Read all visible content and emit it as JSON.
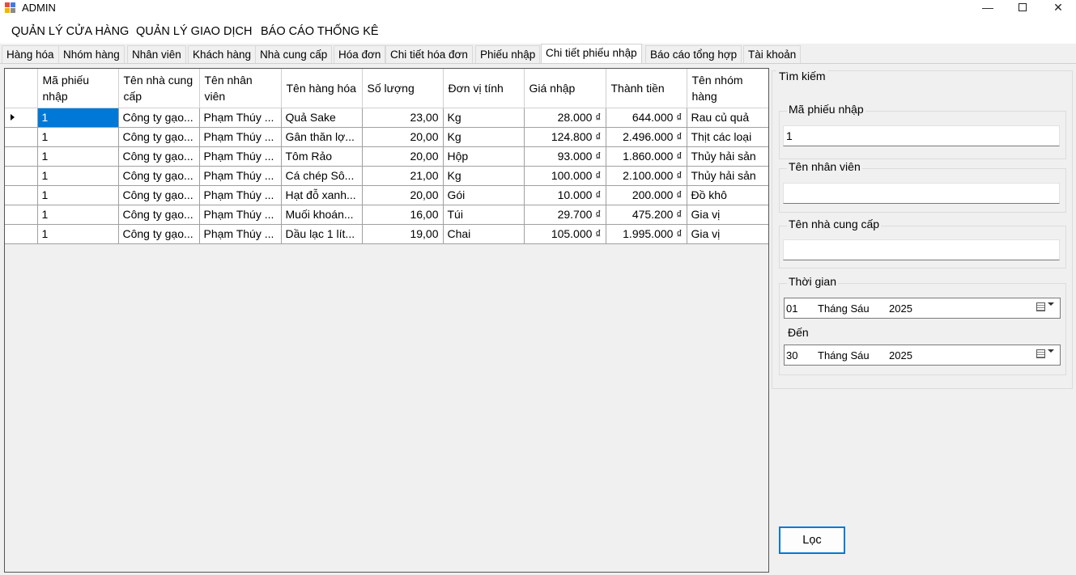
{
  "window": {
    "title": "ADMIN",
    "minimize": "—",
    "close": "✕"
  },
  "menu": [
    "QUẢN LÝ CỬA HÀNG",
    "QUẢN LÝ GIAO DỊCH",
    "BÁO CÁO THỐNG KÊ"
  ],
  "tabs": [
    "Hàng hóa",
    "Nhóm hàng",
    "Nhân viên",
    "Khách hàng",
    "Nhà cung cấp",
    "Hóa đơn",
    "Chi tiết hóa đơn",
    "Phiếu nhập",
    "Chi tiết phiếu nhập",
    "Báo cáo tổng hợp",
    "Tài khoản"
  ],
  "active_tab": "Chi tiết phiếu nhập",
  "grid": {
    "headers": [
      "Mã phiếu nhập",
      "Tên nhà cung cấp",
      "Tên nhân viên",
      "Tên hàng hóa",
      "Số lượng",
      "Đơn vị tính",
      "Giá nhập",
      "Thành tiền",
      "Tên nhóm hàng"
    ],
    "rows": [
      [
        "1",
        "Công ty gạo...",
        "Phạm Thúy ...",
        "Quả Sake",
        "23,00",
        "Kg",
        "28.000 ₫",
        "644.000 ₫",
        "Rau củ quả"
      ],
      [
        "1",
        "Công ty gạo...",
        "Phạm Thúy ...",
        "Gân thăn lợ...",
        "20,00",
        "Kg",
        "124.800 ₫",
        "2.496.000 ₫",
        "Thịt các loại"
      ],
      [
        "1",
        "Công ty gạo...",
        "Phạm Thúy ...",
        "Tôm Rảo",
        "20,00",
        "Hộp",
        "93.000 ₫",
        "1.860.000 ₫",
        "Thủy hải sản"
      ],
      [
        "1",
        "Công ty gạo...",
        "Phạm Thúy ...",
        "Cá chép Sô...",
        "21,00",
        "Kg",
        "100.000 ₫",
        "2.100.000 ₫",
        "Thủy hải sản"
      ],
      [
        "1",
        "Công ty gạo...",
        "Phạm Thúy ...",
        "Hạt đỗ xanh...",
        "20,00",
        "Gói",
        "10.000 ₫",
        "200.000 ₫",
        "Đồ khô"
      ],
      [
        "1",
        "Công ty gạo...",
        "Phạm Thúy ...",
        "Muối khoán...",
        "16,00",
        "Túi",
        "29.700 ₫",
        "475.200 ₫",
        "Gia vị"
      ],
      [
        "1",
        "Công ty gạo...",
        "Phạm Thúy ...",
        "Dầu lạc 1 lít...",
        "19,00",
        "Chai",
        "105.000 ₫",
        "1.995.000 ₫",
        "Gia vị"
      ]
    ]
  },
  "search": {
    "title": "Tìm kiếm",
    "receipt_label": "Mã phiếu nhập",
    "receipt_value": "1",
    "employee_label": "Tên nhân viên",
    "employee_value": "",
    "supplier_label": "Tên nhà cung cấp",
    "supplier_value": "",
    "time_label": "Thời gian",
    "from": {
      "day": "01",
      "month": "Tháng Sáu",
      "year": "2025"
    },
    "to_label": "Đến",
    "to": {
      "day": "30",
      "month": "Tháng Sáu",
      "year": "2025"
    },
    "filter_button": "Lọc"
  }
}
